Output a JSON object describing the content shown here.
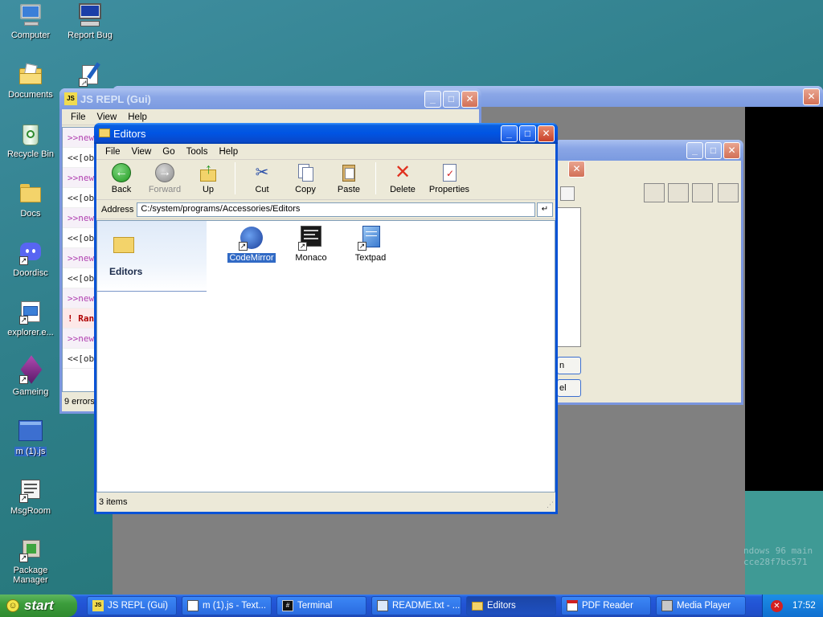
{
  "desktop": {
    "icons": [
      {
        "label": "Computer",
        "icon": "computer-icon"
      },
      {
        "label": "Report Bug",
        "icon": "report-bug-icon"
      },
      {
        "label": "Documents",
        "icon": "documents-folder-icon"
      },
      {
        "label": "Recycle Bin",
        "icon": "recycle-bin-icon"
      },
      {
        "label": "Docs",
        "icon": "folder-icon"
      },
      {
        "label": "Doordisc",
        "icon": "doordisc-icon"
      },
      {
        "label": "explorer.e...",
        "icon": "explorer-icon"
      },
      {
        "label": "Gameing",
        "icon": "gameing-icon"
      },
      {
        "label": "m (1).js",
        "icon": "js-file-icon"
      },
      {
        "label": "MsgRoom",
        "icon": "msgroom-icon"
      },
      {
        "label": "Package Manager",
        "icon": "package-manager-icon"
      }
    ],
    "watermark_line1": "ndows 96 main",
    "watermark_line2": "cce28f7bc571"
  },
  "repl_window": {
    "title": "JS REPL (Gui)",
    "menu": [
      "File",
      "View",
      "Help"
    ],
    "lines": [
      ">>new",
      "<<[obje",
      ">>new",
      "<<[obje",
      ">>new",
      "<<[obje",
      ">>new",
      "<<[obje",
      ">>new",
      "! Ran",
      ">>new",
      "<<[obje"
    ],
    "status": "9 errors"
  },
  "back_dialog": {
    "button1_partial": "n",
    "button2_partial": "el"
  },
  "explorer": {
    "title": "Editors",
    "menu": [
      "File",
      "View",
      "Go",
      "Tools",
      "Help"
    ],
    "toolbar": {
      "back": "Back",
      "forward": "Forward",
      "up": "Up",
      "cut": "Cut",
      "copy": "Copy",
      "paste": "Paste",
      "delete": "Delete",
      "properties": "Properties"
    },
    "address_label": "Address",
    "address_value": "C:/system/programs/Accessories/Editors",
    "go_glyph": "↵",
    "sidebar_title": "Editors",
    "files": [
      {
        "label": "CodeMirror",
        "icon": "codemirror-icon",
        "selected": true
      },
      {
        "label": "Monaco",
        "icon": "monaco-icon",
        "selected": false
      },
      {
        "label": "Textpad",
        "icon": "textpad-icon",
        "selected": false
      }
    ],
    "status": "3 items"
  },
  "taskbar": {
    "start_label": "start",
    "tasks": [
      {
        "label": "JS REPL (Gui)",
        "icon": "js-icon"
      },
      {
        "label": "m (1).js - Text...",
        "icon": "text-file-icon"
      },
      {
        "label": "Terminal",
        "icon": "terminal-icon"
      },
      {
        "label": "README.txt - ...",
        "icon": "text-file-icon"
      },
      {
        "label": "Editors",
        "icon": "folder-icon",
        "active": true
      },
      {
        "label": "PDF Reader",
        "icon": "pdf-icon"
      },
      {
        "label": "Media Player",
        "icon": "media-player-icon"
      }
    ],
    "clock": "17:52"
  },
  "colors": {
    "titlebar_active": "#0054e3",
    "selection": "#316ac5",
    "desktop": "#2f7f8a"
  }
}
